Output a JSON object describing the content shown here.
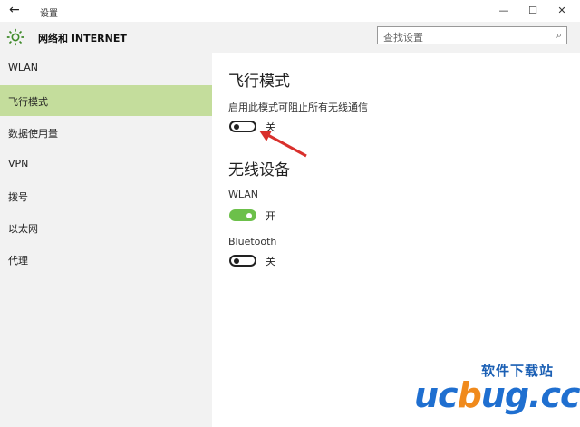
{
  "window": {
    "title": "设置",
    "back_icon": "back-arrow-icon",
    "minimize_glyph": "—",
    "maximize_glyph": "☐",
    "close_glyph": "✕"
  },
  "header": {
    "icon": "gear-icon",
    "title": "网络和 INTERNET",
    "search_placeholder": "查找设置",
    "search_icon_glyph": "⌕"
  },
  "sidebar": {
    "items": [
      {
        "label": "WLAN",
        "active": false
      },
      {
        "label": "飞行模式",
        "active": true
      },
      {
        "label": "数据使用量",
        "active": false
      },
      {
        "label": "VPN",
        "active": false
      },
      {
        "label": "拨号",
        "active": false
      },
      {
        "label": "以太网",
        "active": false
      },
      {
        "label": "代理",
        "active": false
      }
    ]
  },
  "main": {
    "airplane": {
      "heading": "飞行模式",
      "description": "启用此模式可阻止所有无线通信",
      "toggle_state": "off",
      "toggle_label": "关"
    },
    "wireless": {
      "heading": "无线设备",
      "wlan": {
        "label": "WLAN",
        "toggle_state": "on",
        "toggle_label": "开"
      },
      "bluetooth": {
        "label": "Bluetooth",
        "toggle_state": "off",
        "toggle_label": "关"
      }
    }
  },
  "colors": {
    "sidebar_active": "#c4dd9c",
    "toggle_on": "#6cc04a",
    "annotation_arrow": "#d9302c"
  },
  "watermark": {
    "top": "软件下载站",
    "main_a": "uc",
    "main_o": "b",
    "main_b": "ug.cc"
  }
}
